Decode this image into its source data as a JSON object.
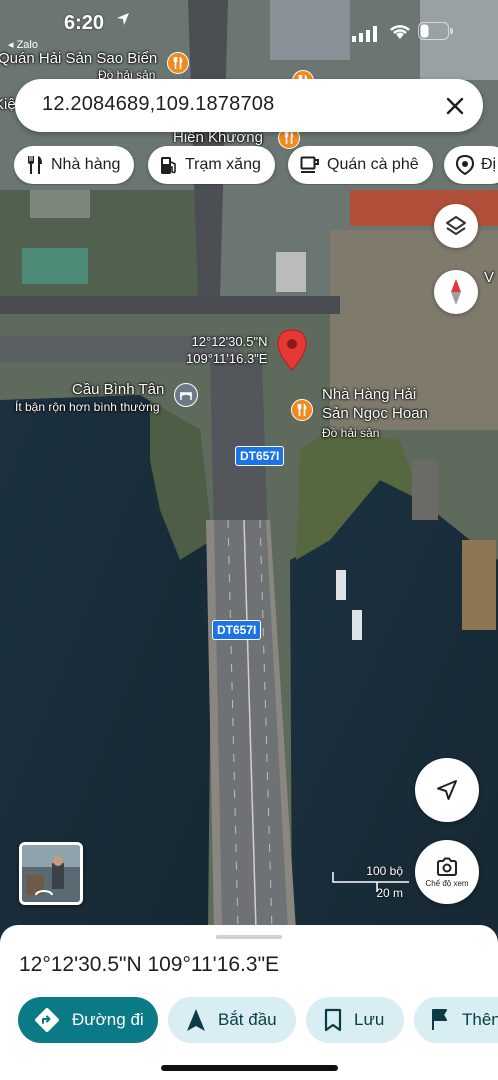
{
  "status_bar": {
    "time": "6:20",
    "back_app": "◂ Zalo"
  },
  "search": {
    "query": "12.2084689,109.1878708"
  },
  "chips": [
    {
      "label": "Nhà hàng",
      "icon": "fork-knife-icon"
    },
    {
      "label": "Trạm xăng",
      "icon": "gas-station-icon"
    },
    {
      "label": "Quán cà phê",
      "icon": "coffee-cup-icon"
    },
    {
      "label": "Đị",
      "icon": "camera-pin-icon"
    }
  ],
  "map": {
    "labels": {
      "sao_bien": "Quán Hải Sản Sao Biển",
      "sao_bien_sub": "Đồ hải sản",
      "hien_khuong": "Hiên Khương",
      "cau_binh_tan": "Cầu Bình Tân",
      "cau_binh_tan_sub": "Ít bận rộn hơn bình thường",
      "ngoc_hoan_1": "Nhà Hàng Hải",
      "ngoc_hoan_2": "Sản Ngọc Hoan",
      "ngoc_hoan_sub": "Đồ hải sản",
      "edge_left": "Kiệ",
      "edge_right": "V"
    },
    "road_shield_1": "DT657I",
    "road_shield_2": "DT657I",
    "pin_lat": "12°12'30.5\"N",
    "pin_lng": "109°11'16.3\"E",
    "scale": {
      "imperial": "100 bộ",
      "metric": "20 m"
    },
    "look_around_label": "Chế độ xem",
    "accent_pin": "#e53935",
    "accent_poi": "#f28b1f"
  },
  "sheet": {
    "title": "12°12'30.5\"N 109°11'16.3\"E",
    "actions": [
      {
        "label": "Đường đi",
        "icon": "directions-icon",
        "style": "primary"
      },
      {
        "label": "Bắt đầu",
        "icon": "navigation-arrow-icon",
        "style": "secondary"
      },
      {
        "label": "Lưu",
        "icon": "bookmark-icon",
        "style": "secondary"
      },
      {
        "label": "Thên",
        "icon": "flag-icon",
        "style": "secondary"
      }
    ],
    "accent": "#0b7a87"
  }
}
